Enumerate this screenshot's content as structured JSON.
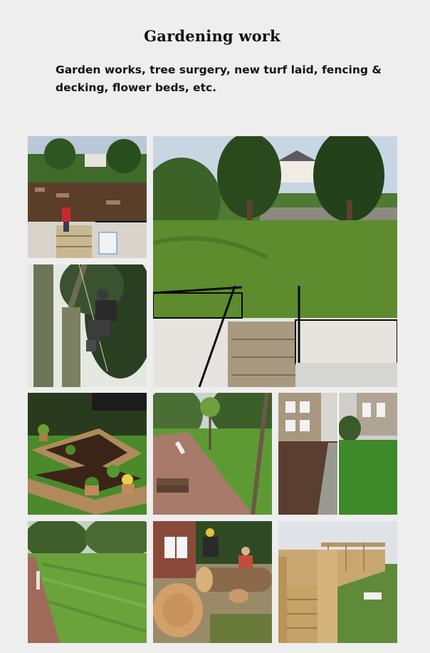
{
  "page": {
    "title": "Gardening work",
    "description": "Garden works, tree surgery, new turf laid, fencing & decking, flower beds, etc."
  },
  "gallery": {
    "photos": [
      {
        "subject": "garden-landscaping-steps"
      },
      {
        "subject": "garden-lawn-railings-steps"
      },
      {
        "subject": "tree-surgeon-climbing"
      },
      {
        "subject": "raised-flower-beds"
      },
      {
        "subject": "garden-path-young-trees"
      },
      {
        "subject": "turf-before-after"
      },
      {
        "subject": "new-turf-laid"
      },
      {
        "subject": "tree-log-cutting"
      },
      {
        "subject": "wooden-decking-fencing"
      }
    ]
  }
}
